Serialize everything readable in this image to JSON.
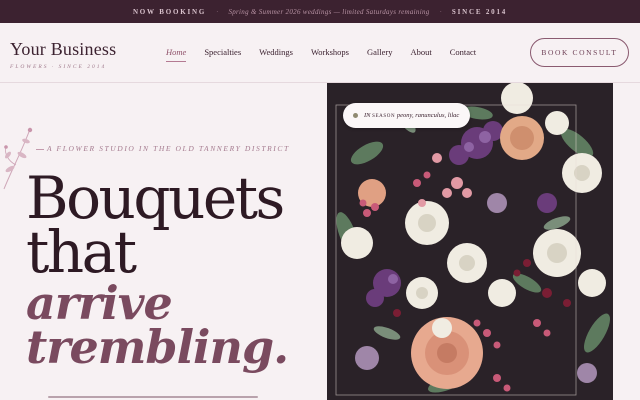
{
  "announcement": {
    "label": "NOW BOOKING",
    "message": "Spring & Summer 2026 weddings — limited Saturdays remaining",
    "year_label": "SINCE 2014"
  },
  "brand": {
    "name": "Your Business",
    "tagline": "FLOWERS · SINCE 2014"
  },
  "nav": {
    "items": [
      {
        "label": "Home",
        "active": true
      },
      {
        "label": "Specialties"
      },
      {
        "label": "Weddings"
      },
      {
        "label": "Workshops"
      },
      {
        "label": "Gallery"
      },
      {
        "label": "About"
      },
      {
        "label": "Contact"
      }
    ]
  },
  "cta": {
    "label": "BOOK CONSULT"
  },
  "hero": {
    "eyebrow": "A FLOWER STUDIO IN THE OLD TANNERY DISTRICT",
    "headline_1": "Bouquets",
    "headline_2": "that",
    "headline_3": "arrive",
    "headline_4": "trembling."
  },
  "season_badge": {
    "prefix": "IN",
    "season": "SEASON",
    "flowers": "peony, ranunculus, lilac"
  },
  "colors": {
    "topbar": "#3c2230",
    "background": "#f7f1f3",
    "accent": "#7a4a5f",
    "ink": "#2e1a24"
  }
}
